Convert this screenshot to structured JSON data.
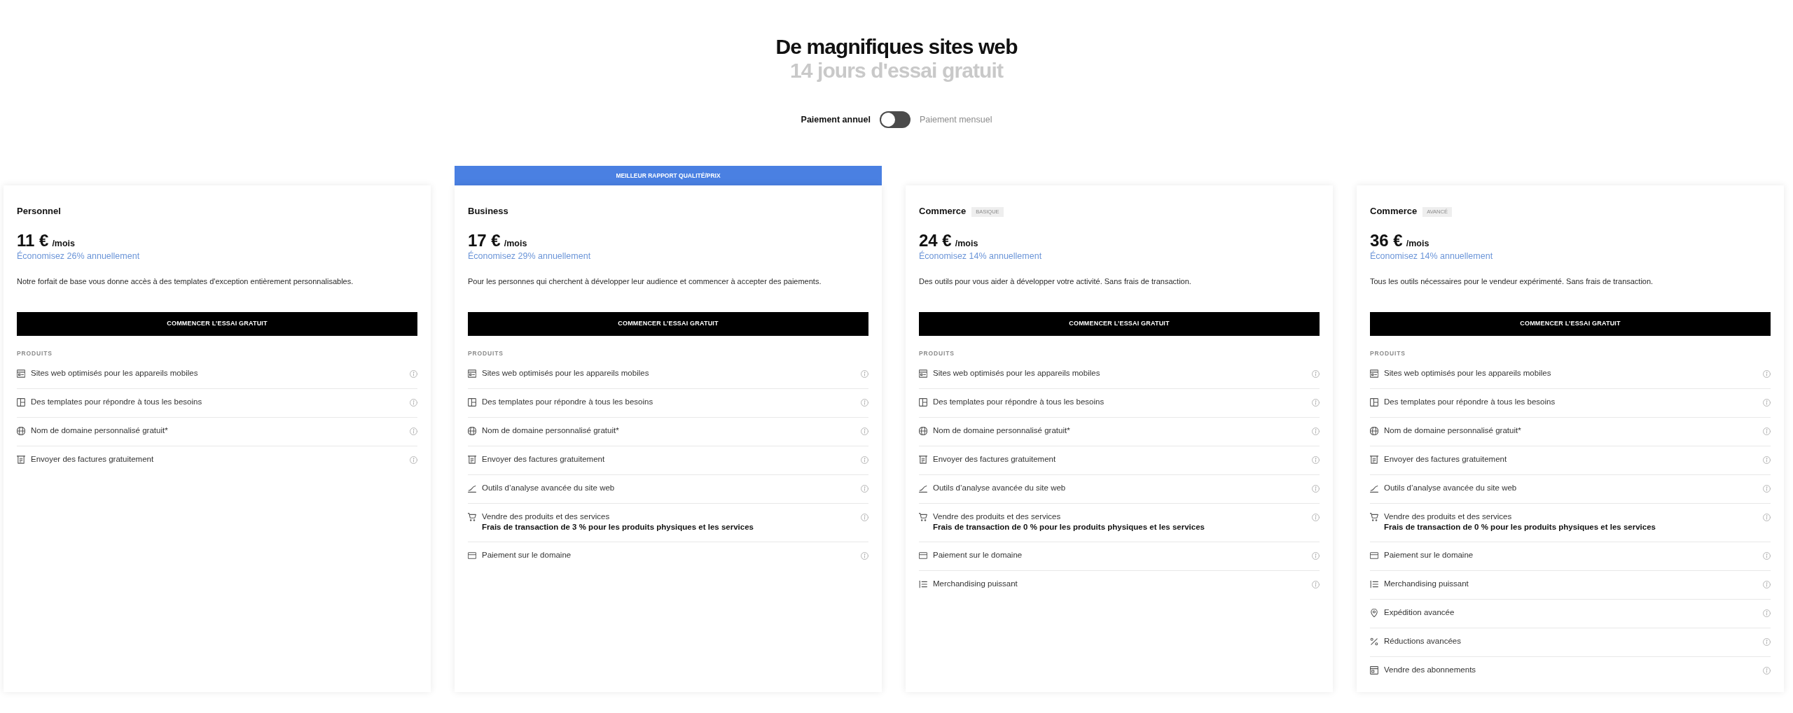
{
  "header": {
    "title": "De magnifiques sites web",
    "subtitle": "14 jours d'essai gratuit"
  },
  "billing": {
    "options": [
      {
        "label": "Paiement annuel",
        "selected": true
      },
      {
        "label": "Paiement mensuel",
        "selected": false
      }
    ]
  },
  "plans": [
    {
      "name": "Personnel",
      "price": "11 €",
      "period": "/mois",
      "savings": "Économisez 26% annuellement",
      "description": "Notre forfait de base vous donne accès à des templates d'exception entièrement personnalisables.",
      "button": "COMMENCER L’ESSAI GRATUIT",
      "section": "PRODUITS",
      "features": [
        {
          "kind": "mobile",
          "label": "Sites web optimisés pour les appareils mobiles"
        },
        {
          "kind": "templates",
          "label": "Des templates pour répondre à tous les besoins"
        },
        {
          "kind": "domain",
          "label": "Nom de domaine personnalisé gratuit*"
        },
        {
          "kind": "invoices",
          "label": "Envoyer des factures gratuitement"
        }
      ]
    },
    {
      "banner": "MEILLEUR RAPPORT QUALITÉ/PRIX",
      "name": "Business",
      "price": "17 €",
      "period": "/mois",
      "savings": "Économisez 29% annuellement",
      "description": "Pour les personnes qui cherchent à développer leur audience et commencer à accepter des paiements.",
      "button": "COMMENCER L’ESSAI GRATUIT",
      "section": "PRODUITS",
      "features": [
        {
          "kind": "mobile",
          "label": "Sites web optimisés pour les appareils mobiles"
        },
        {
          "kind": "templates",
          "label": "Des templates pour répondre à tous les besoins"
        },
        {
          "kind": "domain",
          "label": "Nom de domaine personnalisé gratuit*"
        },
        {
          "kind": "invoices",
          "label": "Envoyer des factures gratuitement"
        },
        {
          "kind": "analytics",
          "label": "Outils d’analyse avancée du site web"
        },
        {
          "kind": "commerce",
          "label": "Vendre des produits et des services",
          "note": "Frais de transaction de 3 % pour les produits physiques et les services"
        },
        {
          "kind": "payments",
          "label": "Paiement sur le domaine"
        }
      ]
    },
    {
      "name": "Commerce",
      "badge": "BASIQUE",
      "price": "24 €",
      "period": "/mois",
      "savings": "Économisez 14% annuellement",
      "description": "Des outils pour vous aider à développer votre activité. Sans frais de transaction.",
      "button": "COMMENCER L’ESSAI GRATUIT",
      "section": "PRODUITS",
      "features": [
        {
          "kind": "mobile",
          "label": "Sites web optimisés pour les appareils mobiles"
        },
        {
          "kind": "templates",
          "label": "Des templates pour répondre à tous les besoins"
        },
        {
          "kind": "domain",
          "label": "Nom de domaine personnalisé gratuit*"
        },
        {
          "kind": "invoices",
          "label": "Envoyer des factures gratuitement"
        },
        {
          "kind": "analytics",
          "label": "Outils d’analyse avancée du site web"
        },
        {
          "kind": "commerce",
          "label": "Vendre des produits et des services",
          "note": "Frais de transaction de 0 % pour les produits physiques et les services"
        },
        {
          "kind": "payments",
          "label": "Paiement sur le domaine"
        },
        {
          "kind": "merchandising",
          "label": "Merchandising puissant"
        }
      ]
    },
    {
      "name": "Commerce",
      "badge": "AVANCÉ",
      "price": "36 €",
      "period": "/mois",
      "savings": "Économisez 14% annuellement",
      "description": "Tous les outils nécessaires pour le vendeur expérimenté. Sans frais de transaction.",
      "button": "COMMENCER L’ESSAI GRATUIT",
      "section": "PRODUITS",
      "features": [
        {
          "kind": "mobile",
          "label": "Sites web optimisés pour les appareils mobiles"
        },
        {
          "kind": "templates",
          "label": "Des templates pour répondre à tous les besoins"
        },
        {
          "kind": "domain",
          "label": "Nom de domaine personnalisé gratuit*"
        },
        {
          "kind": "invoices",
          "label": "Envoyer des factures gratuitement"
        },
        {
          "kind": "analytics",
          "label": "Outils d’analyse avancée du site web"
        },
        {
          "kind": "commerce",
          "label": "Vendre des produits et des services",
          "note": "Frais de transaction de 0 % pour les produits physiques et les services"
        },
        {
          "kind": "payments",
          "label": "Paiement sur le domaine"
        },
        {
          "kind": "merchandising",
          "label": "Merchandising puissant"
        },
        {
          "kind": "shipping",
          "label": "Expédition avancée"
        },
        {
          "kind": "discounts",
          "label": "Réductions avancées"
        },
        {
          "kind": "subscriptions",
          "label": "Vendre des abonnements"
        }
      ]
    }
  ]
}
